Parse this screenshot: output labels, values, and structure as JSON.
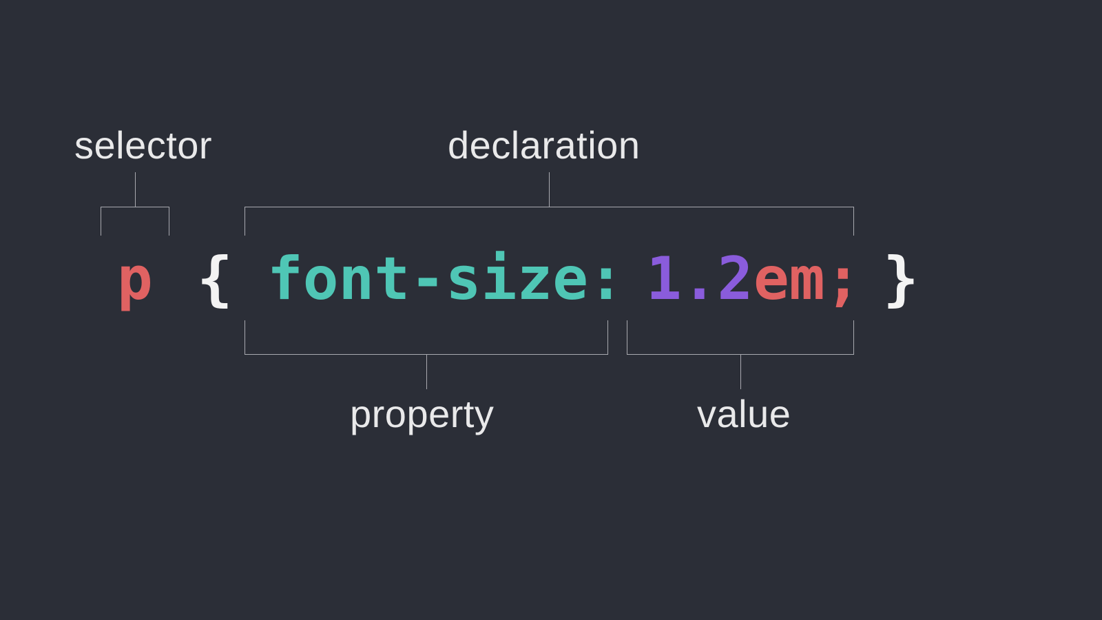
{
  "labels": {
    "selector": "selector",
    "declaration": "declaration",
    "property": "property",
    "value": "value"
  },
  "code": {
    "selector": "p",
    "brace_open": "{",
    "property": "font-size",
    "colon": ":",
    "value_number": "1.2",
    "value_unit": "em",
    "semicolon": ";",
    "brace_close": "}"
  },
  "colors": {
    "background": "#2b2e37",
    "label_text": "#e9e9ea",
    "bracket": "#a9aab0",
    "selector": "#e06262",
    "brace": "#f3f3f3",
    "property": "#4fc6b5",
    "value_number": "#8a5cdc",
    "value_unit": "#e06262",
    "semicolon": "#e06262"
  },
  "diagram": {
    "description": "CSS rule anatomy: selector, declaration block containing a property:value pair"
  }
}
